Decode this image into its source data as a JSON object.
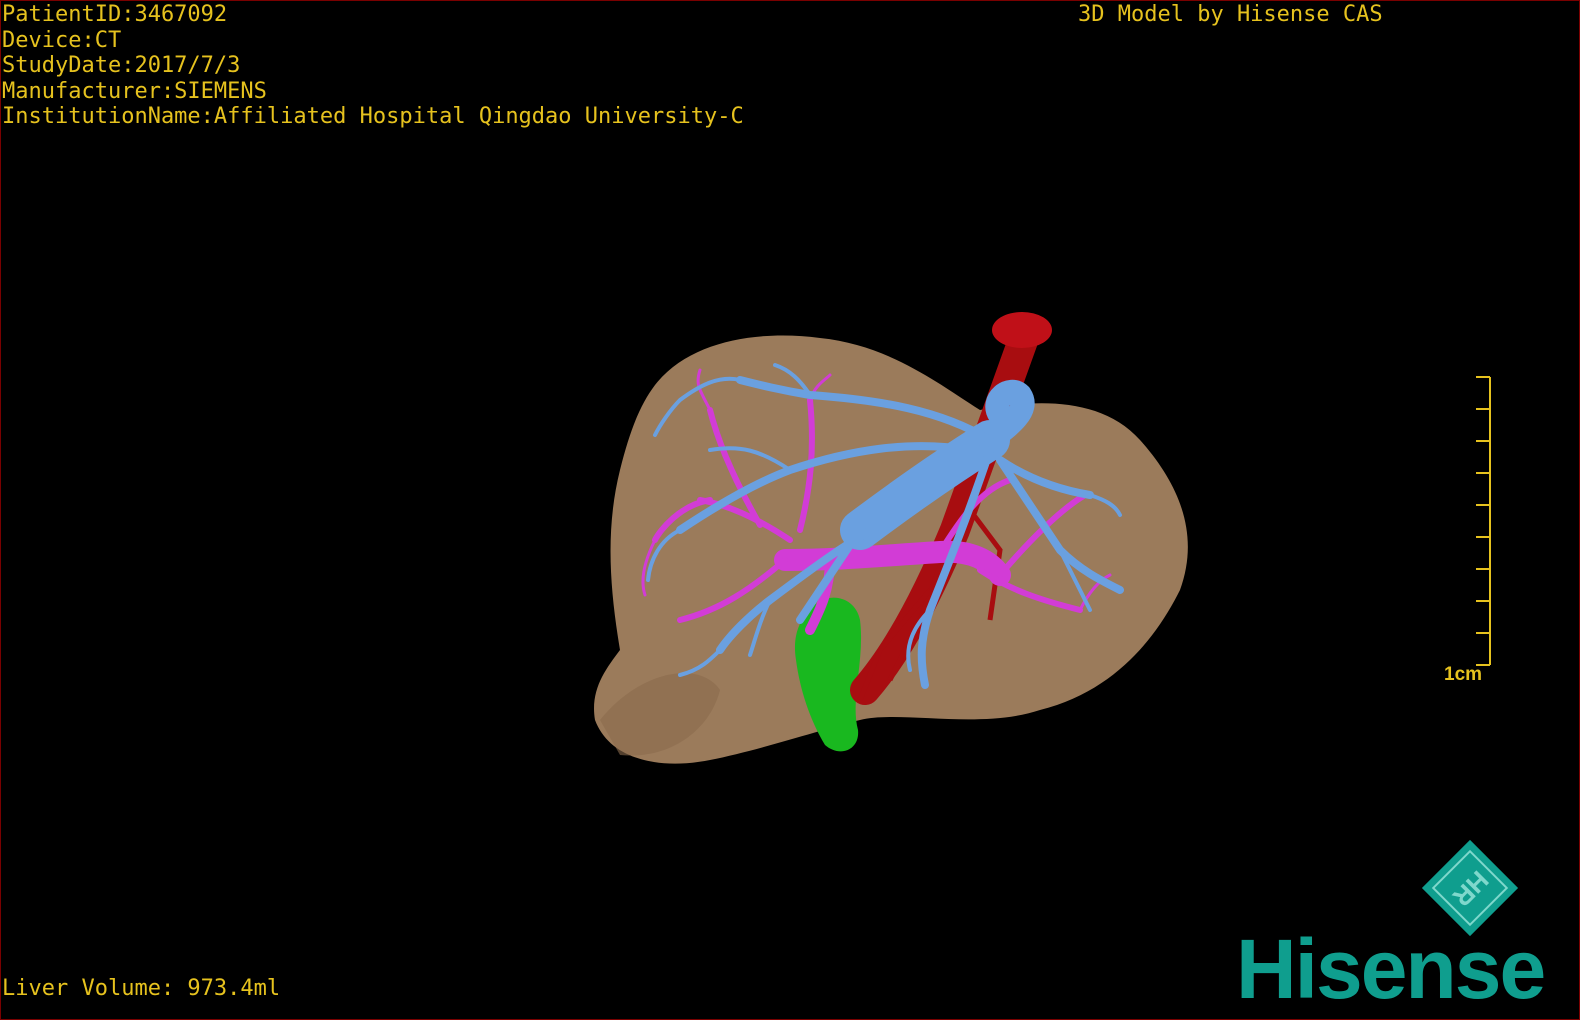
{
  "overlay": {
    "patient_id": "PatientID:3467092",
    "device": "Device:CT",
    "study_date": "StudyDate:2017/7/3",
    "manufacturer": "Manufacturer:SIEMENS",
    "institution": "InstitutionName:Affiliated Hospital Qingdao University-C",
    "credit": "3D Model by Hisense CAS",
    "liver_volume": "Liver Volume: 973.4ml"
  },
  "scale_bar": {
    "label": "1cm"
  },
  "brand": {
    "name": "Hisense",
    "mark_letters": "HR",
    "color": "#0f9e8e"
  },
  "colors": {
    "overlay_text": "#e6c21e",
    "liver": "#9b7b5b",
    "hepatic_vein": "#6aa0e0",
    "portal_vein": "#d23cd6",
    "artery": "#a80d10",
    "bile_duct": "#19b81f",
    "frame_border": "#7a0000"
  }
}
